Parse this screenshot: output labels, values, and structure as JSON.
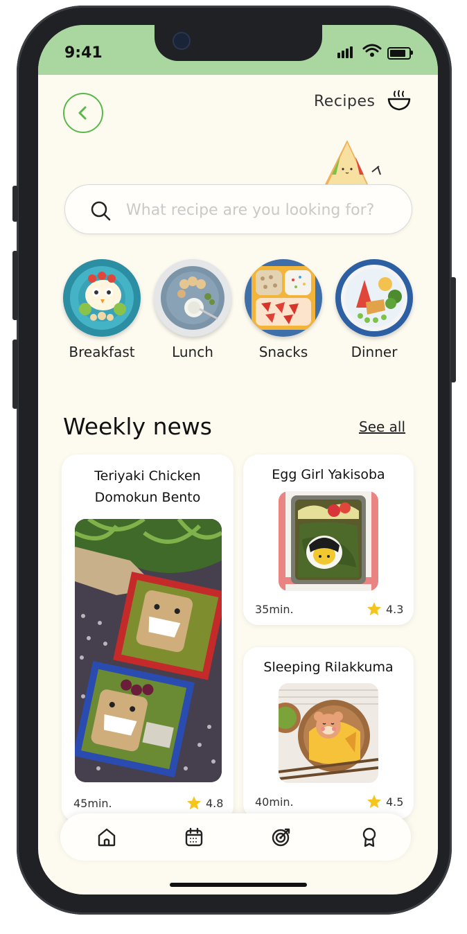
{
  "status": {
    "time": "9:41"
  },
  "header": {
    "title": "Recipes",
    "back_icon": "chevron-left-icon",
    "title_icon": "bowl-icon"
  },
  "search": {
    "placeholder": "What recipe are you looking for?"
  },
  "categories": [
    {
      "label": "Breakfast"
    },
    {
      "label": "Lunch"
    },
    {
      "label": "Snacks"
    },
    {
      "label": "Dinner"
    }
  ],
  "weekly": {
    "title": "Weekly news",
    "see_all": "See all"
  },
  "recipes": [
    {
      "title": "Teriyaki Chicken Domokun Bento",
      "time": "45min.",
      "rating": "4.8"
    },
    {
      "title": "Egg Girl Yakisoba",
      "time": "35min.",
      "rating": "4.3"
    },
    {
      "title": "Sleeping Rilakkuma",
      "time": "40min.",
      "rating": "4.5"
    }
  ],
  "tabs": [
    {
      "icon": "home-icon"
    },
    {
      "icon": "calendar-icon"
    },
    {
      "icon": "target-icon"
    },
    {
      "icon": "award-icon"
    }
  ],
  "colors": {
    "status_bar": "#a9d79f",
    "accent_green": "#58b84b",
    "background": "#fdfbf0",
    "star": "#f4c51c"
  }
}
